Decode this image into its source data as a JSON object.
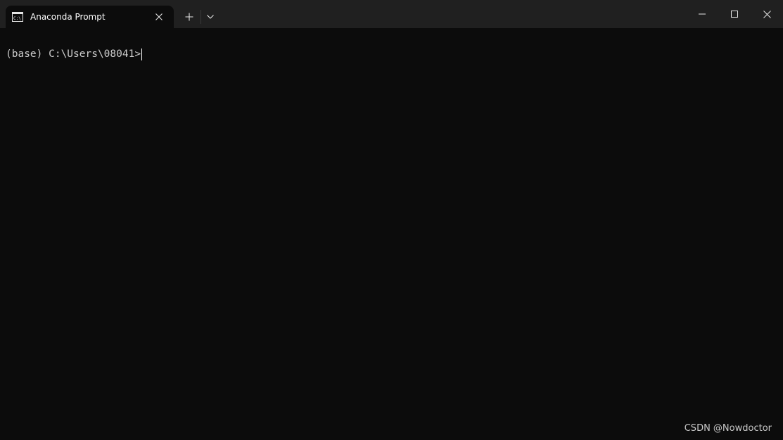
{
  "window": {
    "tab_title": "Anaconda Prompt",
    "tab_icon": "console-icon",
    "new_tab_icon": "plus-icon",
    "dropdown_icon": "chevron-down-icon",
    "controls": [
      "minimize-icon",
      "maximize-icon",
      "close-icon"
    ]
  },
  "terminal": {
    "prompt": "(base) C:\\Users\\08041>",
    "background": "#0c0c0c",
    "foreground": "#cccccc"
  },
  "watermark": {
    "text": "CSDN @Nowdoctor"
  }
}
